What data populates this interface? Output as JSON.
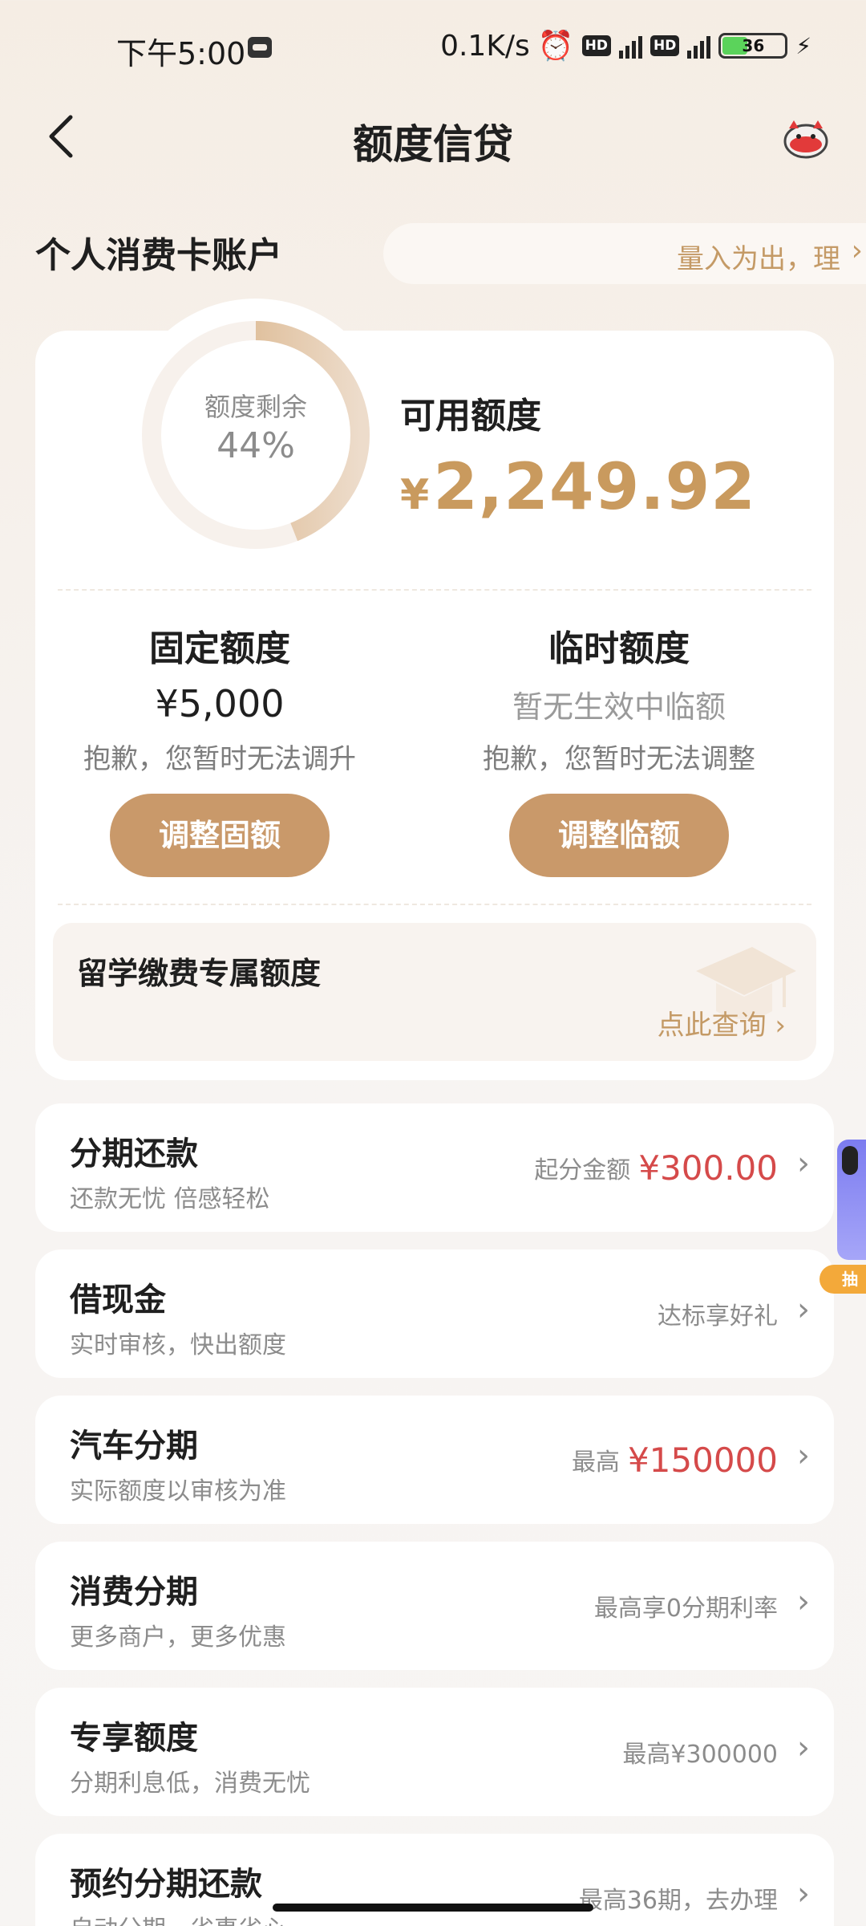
{
  "status_bar": {
    "time": "下午5:00",
    "speed": "0.1K/s",
    "hd": "HD",
    "network": "4G",
    "battery": "36"
  },
  "header": {
    "title": "额度信贷"
  },
  "account": {
    "title": "个人消费卡账户",
    "slogan": "量入为出，理"
  },
  "credit": {
    "ring_label": "额度剩余",
    "ring_percent": "44%",
    "ring_fraction": 0.44,
    "available_label": "可用额度",
    "currency": "¥",
    "available_amount": "2,249.92",
    "accent_color": "#c99a5e"
  },
  "fixed": {
    "title": "固定额度",
    "value": "¥5,000",
    "note": "抱歉，您暂时无法调升",
    "button": "调整固额"
  },
  "temp": {
    "title": "临时额度",
    "value": "暂无生效中临额",
    "note": "抱歉，您暂时无法调整",
    "button": "调整临额"
  },
  "study": {
    "title": "留学缴费专属额度",
    "link": "点此查询"
  },
  "items": [
    {
      "title": "分期还款",
      "sub": "还款无忧 倍感轻松",
      "right_label": "起分金额",
      "right_value": "¥300.00"
    },
    {
      "title": "借现金",
      "sub": "实时审核，快出额度",
      "right_label": "达标享好礼",
      "right_value": ""
    },
    {
      "title": "汽车分期",
      "sub": "实际额度以审核为准",
      "right_label": "最高",
      "right_value": "¥150000"
    },
    {
      "title": "消费分期",
      "sub": "更多商户，更多优惠",
      "right_label": "最高享0分期利率",
      "right_value": ""
    },
    {
      "title": "专享额度",
      "sub": "分期利息低，消费无忧",
      "right_label": "最高¥300000",
      "right_value": ""
    },
    {
      "title": "预约分期还款",
      "sub": "自动分期，省事省心",
      "right_label": "最高36期，去办理",
      "right_value": ""
    }
  ],
  "float_ad": {
    "tag": "抽奖"
  }
}
